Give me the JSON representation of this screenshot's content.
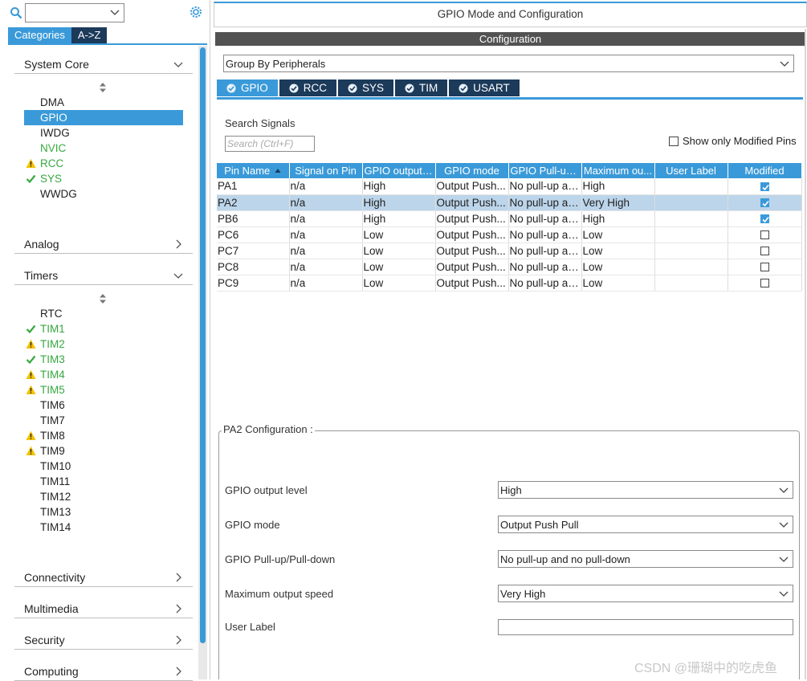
{
  "left": {
    "category_tabs": [
      "Categories",
      "A->Z"
    ],
    "sections": {
      "system_core": "System Core",
      "analog": "Analog",
      "timers": "Timers",
      "connectivity": "Connectivity",
      "multimedia": "Multimedia",
      "security": "Security",
      "computing": "Computing"
    },
    "system_core_items": [
      {
        "label": "DMA",
        "status": "none"
      },
      {
        "label": "GPIO",
        "status": "selected"
      },
      {
        "label": "IWDG",
        "status": "none"
      },
      {
        "label": "NVIC",
        "status": "enabled"
      },
      {
        "label": "RCC",
        "status": "warning"
      },
      {
        "label": "SYS",
        "status": "ok"
      },
      {
        "label": "WWDG",
        "status": "none"
      }
    ],
    "timer_items": [
      {
        "label": "RTC",
        "status": "none"
      },
      {
        "label": "TIM1",
        "status": "ok"
      },
      {
        "label": "TIM2",
        "status": "warning"
      },
      {
        "label": "TIM3",
        "status": "ok"
      },
      {
        "label": "TIM4",
        "status": "warning"
      },
      {
        "label": "TIM5",
        "status": "warning"
      },
      {
        "label": "TIM6",
        "status": "none"
      },
      {
        "label": "TIM7",
        "status": "none"
      },
      {
        "label": "TIM8",
        "status": "warning-plain"
      },
      {
        "label": "TIM9",
        "status": "warning-plain"
      },
      {
        "label": "TIM10",
        "status": "none"
      },
      {
        "label": "TIM11",
        "status": "none"
      },
      {
        "label": "TIM12",
        "status": "none"
      },
      {
        "label": "TIM13",
        "status": "none"
      },
      {
        "label": "TIM14",
        "status": "none"
      }
    ]
  },
  "right": {
    "title": "GPIO Mode and Configuration",
    "config_header": "Configuration",
    "group_by": "Group By Peripherals",
    "peripheral_tabs": [
      "GPIO",
      "RCC",
      "SYS",
      "TIM",
      "USART"
    ],
    "search_label": "Search Signals",
    "search_placeholder": "Search (Ctrl+F)",
    "show_modified": "Show only Modified Pins",
    "columns": [
      "Pin Name",
      "Signal on Pin",
      "GPIO output ...",
      "GPIO mode",
      "GPIO Pull-up...",
      "Maximum ou...",
      "User Label",
      "Modified"
    ],
    "rows": [
      {
        "pin": "PA1",
        "signal": "n/a",
        "level": "High",
        "mode": "Output Push...",
        "pull": "No pull-up an...",
        "speed": "High",
        "label": "",
        "modified": true
      },
      {
        "pin": "PA2",
        "signal": "n/a",
        "level": "High",
        "mode": "Output Push...",
        "pull": "No pull-up an...",
        "speed": "Very High",
        "label": "",
        "modified": true
      },
      {
        "pin": "PB6",
        "signal": "n/a",
        "level": "High",
        "mode": "Output Push...",
        "pull": "No pull-up an...",
        "speed": "High",
        "label": "",
        "modified": true
      },
      {
        "pin": "PC6",
        "signal": "n/a",
        "level": "Low",
        "mode": "Output Push...",
        "pull": "No pull-up an...",
        "speed": "Low",
        "label": "",
        "modified": false
      },
      {
        "pin": "PC7",
        "signal": "n/a",
        "level": "Low",
        "mode": "Output Push...",
        "pull": "No pull-up an...",
        "speed": "Low",
        "label": "",
        "modified": false
      },
      {
        "pin": "PC8",
        "signal": "n/a",
        "level": "Low",
        "mode": "Output Push...",
        "pull": "No pull-up an...",
        "speed": "Low",
        "label": "",
        "modified": false
      },
      {
        "pin": "PC9",
        "signal": "n/a",
        "level": "Low",
        "mode": "Output Push...",
        "pull": "No pull-up an...",
        "speed": "Low",
        "label": "",
        "modified": false
      }
    ],
    "selected_row": "PA2",
    "config_title": "PA2 Configuration :",
    "fields": [
      {
        "label": "GPIO output level",
        "value": "High"
      },
      {
        "label": "GPIO mode",
        "value": "Output Push Pull"
      },
      {
        "label": "GPIO Pull-up/Pull-down",
        "value": "No pull-up and no pull-down"
      },
      {
        "label": "Maximum output speed",
        "value": "Very High"
      }
    ],
    "user_label": {
      "label": "User Label",
      "value": ""
    }
  },
  "watermark": "CSDN @珊瑚中的吃虎鱼",
  "colors": {
    "accent": "#3a9ad9",
    "dark_tab": "#1c3a5a",
    "ok_green": "#36a83f",
    "warning_yellow": "#f2c200"
  }
}
